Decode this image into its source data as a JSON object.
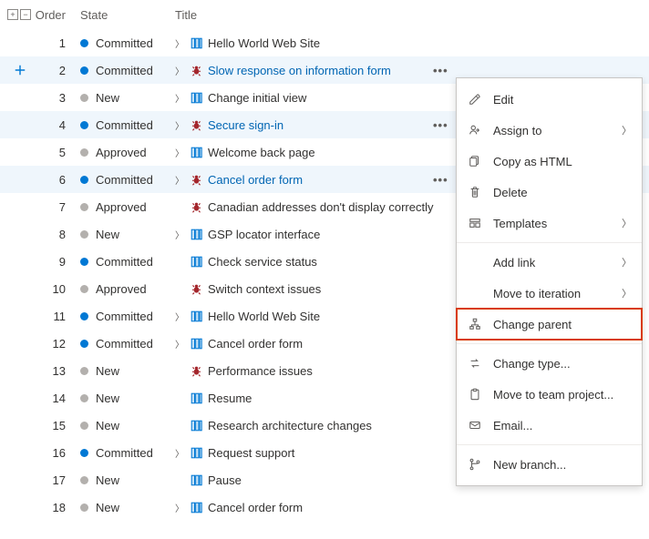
{
  "columns": {
    "order": "Order",
    "state": "State",
    "title": "Title"
  },
  "rows": [
    {
      "order": "1",
      "state": "Committed",
      "type": "pbi",
      "title": "Hello World Web Site",
      "expandable": true,
      "selected": false,
      "link": false
    },
    {
      "order": "2",
      "state": "Committed",
      "type": "bug",
      "title": "Slow response on information form",
      "expandable": true,
      "selected": true,
      "link": true,
      "more": true,
      "addbtn": true
    },
    {
      "order": "3",
      "state": "New",
      "type": "pbi",
      "title": "Change initial view",
      "expandable": true,
      "selected": false,
      "link": false
    },
    {
      "order": "4",
      "state": "Committed",
      "type": "bug",
      "title": "Secure sign-in",
      "expandable": true,
      "selected": true,
      "link": true,
      "more": true
    },
    {
      "order": "5",
      "state": "Approved",
      "type": "pbi",
      "title": "Welcome back page",
      "expandable": true,
      "selected": false,
      "link": false
    },
    {
      "order": "6",
      "state": "Committed",
      "type": "bug",
      "title": "Cancel order form",
      "expandable": true,
      "selected": true,
      "link": true,
      "more": true
    },
    {
      "order": "7",
      "state": "Approved",
      "type": "bug",
      "title": "Canadian addresses don't display correctly",
      "expandable": false,
      "selected": false,
      "link": false
    },
    {
      "order": "8",
      "state": "New",
      "type": "pbi",
      "title": "GSP locator interface",
      "expandable": true,
      "selected": false,
      "link": false
    },
    {
      "order": "9",
      "state": "Committed",
      "type": "pbi",
      "title": "Check service status",
      "expandable": false,
      "selected": false,
      "link": false
    },
    {
      "order": "10",
      "state": "Approved",
      "type": "bug",
      "title": "Switch context issues",
      "expandable": false,
      "selected": false,
      "link": false
    },
    {
      "order": "11",
      "state": "Committed",
      "type": "pbi",
      "title": "Hello World Web Site",
      "expandable": true,
      "selected": false,
      "link": false
    },
    {
      "order": "12",
      "state": "Committed",
      "type": "pbi",
      "title": "Cancel order form",
      "expandable": true,
      "selected": false,
      "link": false
    },
    {
      "order": "13",
      "state": "New",
      "type": "bug",
      "title": "Performance issues",
      "expandable": false,
      "selected": false,
      "link": false
    },
    {
      "order": "14",
      "state": "New",
      "type": "pbi",
      "title": "Resume",
      "expandable": false,
      "selected": false,
      "link": false
    },
    {
      "order": "15",
      "state": "New",
      "type": "pbi",
      "title": "Research architecture changes",
      "expandable": false,
      "selected": false,
      "link": false
    },
    {
      "order": "16",
      "state": "Committed",
      "type": "pbi",
      "title": "Request support",
      "expandable": true,
      "selected": false,
      "link": false
    },
    {
      "order": "17",
      "state": "New",
      "type": "pbi",
      "title": "Pause",
      "expandable": false,
      "selected": false,
      "link": false
    },
    {
      "order": "18",
      "state": "New",
      "type": "pbi",
      "title": "Cancel order form",
      "expandable": true,
      "selected": false,
      "link": false
    }
  ],
  "menu": {
    "edit": "Edit",
    "assign_to": "Assign to",
    "copy_html": "Copy as HTML",
    "delete": "Delete",
    "templates": "Templates",
    "add_link": "Add link",
    "move_iteration": "Move to iteration",
    "change_parent": "Change parent",
    "change_type": "Change type...",
    "move_team": "Move to team project...",
    "email": "Email...",
    "new_branch": "New branch..."
  }
}
